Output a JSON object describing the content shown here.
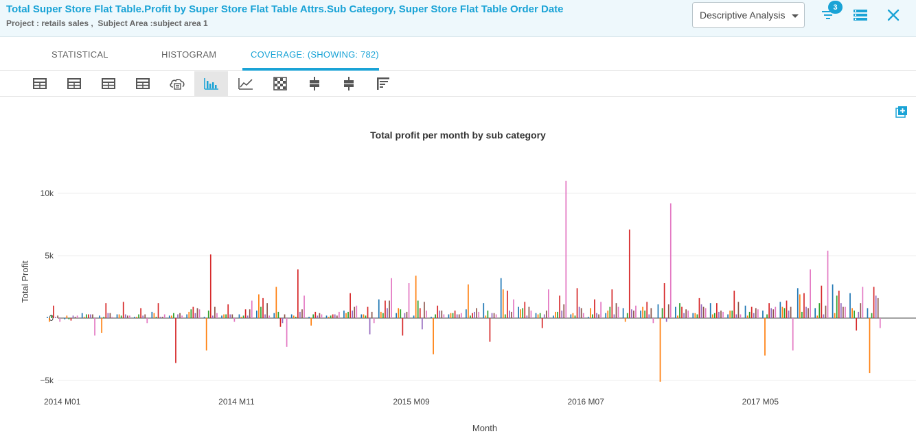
{
  "header": {
    "title": "Total Super Store Flat Table.Profit by Super Store Flat Table Attrs.Sub Category, Super Store Flat Table Order Date",
    "subtitle": "Project : retails sales ,  Subject Area :subject area 1",
    "analysis_select": "Descriptive Analysis",
    "filter_badge": "3",
    "icons": [
      "filter-icon",
      "list-icon",
      "close-icon"
    ]
  },
  "tabs": [
    {
      "label": "STATISTICAL",
      "active": false
    },
    {
      "label": "HISTOGRAM",
      "active": false
    },
    {
      "label": "COVERAGE: (SHOWING: 782)",
      "active": true
    }
  ],
  "toolbar": {
    "tools": [
      "table-icon",
      "table-icon",
      "table-icon",
      "table-icon",
      "cloud-icon",
      "bar-chart-icon",
      "line-chart-icon",
      "heatmap-icon",
      "box-plot-icon",
      "box-plot-icon",
      "tree-icon"
    ],
    "active_tool": "bar-chart-icon"
  },
  "chart_data": {
    "type": "bar",
    "title": "Total profit per month by sub category",
    "xlabel": "Month",
    "ylabel": "Total Profit",
    "ylim": [
      -5500,
      12000
    ],
    "yticks": [
      {
        "value": 10000,
        "label": "10k"
      },
      {
        "value": 5000,
        "label": "5k"
      },
      {
        "value": 0,
        "label": "0"
      },
      {
        "value": -5000,
        "label": "−5k"
      }
    ],
    "xticks": [
      {
        "month_index": 0,
        "label": "2014 M01"
      },
      {
        "month_index": 10,
        "label": "2014 M11"
      },
      {
        "month_index": 20,
        "label": "2015 M09"
      },
      {
        "month_index": 30,
        "label": "2016 M07"
      },
      {
        "month_index": 40,
        "label": "2017 M05"
      }
    ],
    "months_count": 48,
    "grid": true,
    "colors": [
      "#1f77b4",
      "#ff7f0e",
      "#2ca02c",
      "#d62728",
      "#9467bd",
      "#8c564b",
      "#e377c2"
    ],
    "series": [
      {
        "values": [
          100,
          -100,
          400,
          200,
          300,
          100,
          500,
          200,
          300,
          100,
          200,
          300,
          600,
          400,
          300,
          100,
          200,
          600,
          300,
          1500,
          400,
          200,
          100,
          300,
          700,
          1200,
          3200,
          900,
          400,
          200,
          300,
          100,
          400,
          800,
          600,
          1100,
          900,
          400,
          1200,
          300,
          1000,
          600,
          1300,
          2400,
          800,
          2700,
          2000,
          800
        ]
      },
      {
        "values": [
          -300,
          200,
          100,
          -1200,
          300,
          100,
          400,
          200,
          500,
          -2600,
          300,
          100,
          1900,
          2500,
          200,
          -600,
          100,
          400,
          300,
          500,
          800,
          3400,
          -2900,
          400,
          2700,
          200,
          2300,
          700,
          300,
          500,
          400,
          800,
          600,
          -300,
          900,
          -5100,
          200,
          400,
          300,
          600,
          200,
          -3000,
          900,
          1900,
          200,
          400,
          800,
          -4400
        ]
      },
      {
        "values": [
          200,
          -100,
          300,
          100,
          200,
          300,
          100,
          400,
          700,
          600,
          300,
          200,
          900,
          500,
          100,
          300,
          200,
          500,
          200,
          400,
          700,
          1400,
          300,
          400,
          200,
          600,
          300,
          800,
          400,
          500,
          200,
          300,
          900,
          400,
          600,
          800,
          1200,
          300,
          400,
          600,
          500,
          300,
          800,
          500,
          1200,
          1800,
          600,
          400
        ]
      },
      {
        "values": [
          1000,
          -200,
          300,
          1200,
          1300,
          800,
          1200,
          -3600,
          900,
          5100,
          1100,
          700,
          1600,
          -700,
          3900,
          500,
          300,
          2000,
          900,
          1400,
          -1400,
          800,
          1000,
          600,
          400,
          -1900,
          2200,
          1300,
          -800,
          1800,
          2400,
          1500,
          2300,
          7100,
          1300,
          2800,
          900,
          1600,
          1200,
          2200,
          900,
          1200,
          1400,
          2000,
          2600,
          2200,
          -1000,
          2500
        ]
      },
      {
        "values": [
          100,
          200,
          300,
          400,
          300,
          200,
          100,
          300,
          400,
          200,
          300,
          200,
          300,
          -400,
          500,
          200,
          300,
          600,
          -1300,
          800,
          400,
          -900,
          600,
          300,
          500,
          400,
          600,
          200,
          300,
          600,
          900,
          400,
          300,
          700,
          300,
          -300,
          400,
          1100,
          500,
          300,
          400,
          800,
          600,
          900,
          300,
          1200,
          500,
          1800
        ]
      },
      {
        "values": [
          200,
          100,
          300,
          400,
          200,
          300,
          100,
          400,
          800,
          900,
          300,
          700,
          1200,
          300,
          700,
          400,
          200,
          900,
          500,
          1400,
          500,
          1300,
          600,
          300,
          800,
          400,
          500,
          900,
          600,
          1100,
          800,
          300,
          1200,
          600,
          800,
          1100,
          700,
          900,
          600,
          1300,
          800,
          700,
          900,
          800,
          1000,
          900,
          1200,
          1600
        ]
      },
      {
        "values": [
          -300,
          200,
          -1400,
          100,
          200,
          -400,
          300,
          200,
          700,
          400,
          -300,
          1400,
          200,
          -2300,
          1800,
          300,
          500,
          1000,
          -400,
          3200,
          2800,
          600,
          300,
          400,
          500,
          300,
          1500,
          600,
          2300,
          11000,
          400,
          1300,
          900,
          1000,
          -400,
          9200,
          600,
          800,
          500,
          300,
          700,
          900,
          -2600,
          3900,
          5400,
          900,
          2500,
          -800
        ]
      }
    ]
  }
}
